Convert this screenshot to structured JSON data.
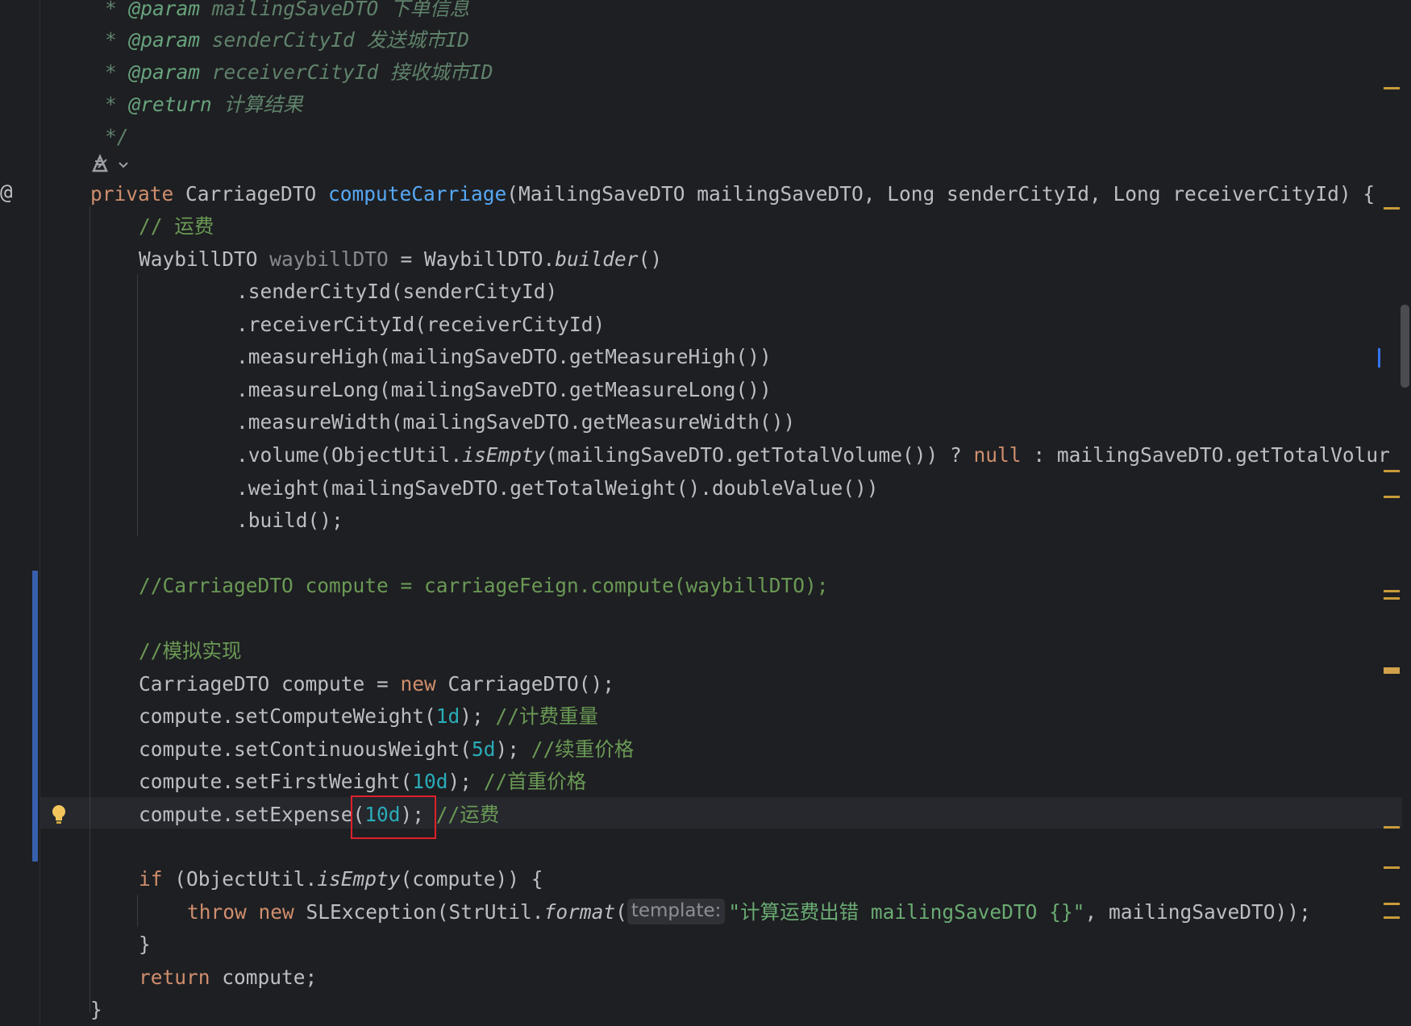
{
  "gutter": {
    "at_marker": "@"
  },
  "lines": {
    "l1_star": "* ",
    "l1_tag": "@param",
    "l1_name": " mailingSaveDTO ",
    "l1_desc": "下单信息",
    "l2_star": "* ",
    "l2_tag": "@param",
    "l2_name": " senderCityId ",
    "l2_desc": "发送城市ID",
    "l3_star": "* ",
    "l3_tag": "@param",
    "l3_name": " receiverCityId ",
    "l3_desc": "接收城市ID",
    "l4_star": "* ",
    "l4_tag": "@return",
    "l4_desc": " 计算结果",
    "l5": "*/",
    "l6_kw": "private",
    "l6_type": " CarriageDTO ",
    "l6_fn": "computeCarriage",
    "l6_rest": "(MailingSaveDTO mailingSaveDTO, Long senderCityId, Long receiverCityId) {",
    "l7": "// 运费",
    "l8_a": "WaybillDTO ",
    "l8_var": "waybillDTO",
    "l8_b": " = WaybillDTO.",
    "l8_it": "builder",
    "l8_c": "()",
    "l9": ".senderCityId(senderCityId)",
    "l10": ".receiverCityId(receiverCityId)",
    "l11": ".measureHigh(mailingSaveDTO.getMeasureHigh())",
    "l12": ".measureLong(mailingSaveDTO.getMeasureLong())",
    "l13": ".measureWidth(mailingSaveDTO.getMeasureWidth())",
    "l14_a": ".volume(ObjectUtil.",
    "l14_it": "isEmpty",
    "l14_b": "(mailingSaveDTO.getTotalVolume()) ? ",
    "l14_null": "null",
    "l14_c": " : mailingSaveDTO.getTotalVolur",
    "l15": ".weight(mailingSaveDTO.getTotalWeight().doubleValue())",
    "l16": ".build();",
    "l17": "//CarriageDTO compute = carriageFeign.compute(waybillDTO);",
    "l18": "//模拟实现",
    "l19_a": "CarriageDTO compute = ",
    "l19_kw": "new",
    "l19_b": " CarriageDTO();",
    "l20_a": "compute.setComputeWeight(",
    "l20_num": "1d",
    "l20_b": "); ",
    "l20_cm": "//计费重量",
    "l21_a": "compute.setContinuousWeight(",
    "l21_num": "5d",
    "l21_b": "); ",
    "l21_cm": "//续重价格",
    "l22_a": "compute.setFirstWeight(",
    "l22_num": "10d",
    "l22_b": "); ",
    "l22_cm": "//首重价格",
    "l23_a": "compute.setExpense(",
    "l23_num": "10d",
    "l23_b": "); ",
    "l23_cm": "//运费",
    "l24_kw": "if",
    "l24_a": " (ObjectUtil.",
    "l24_it": "isEmpty",
    "l24_b": "(compute)) {",
    "l25_kw1": "throw",
    "l25_sp": " ",
    "l25_kw2": "new",
    "l25_a": " SLException(StrUtil.",
    "l25_it": "format",
    "l25_b": "(",
    "l25_hint": "template:",
    "l25_str": "\"计算运费出错 mailingSaveDTO {}\"",
    "l25_c": ", mailingSaveDTO));",
    "l26": "}",
    "l27_kw": "return",
    "l27_a": " compute;",
    "l28": "}"
  },
  "colors": {
    "background": "#1e1f22",
    "keyword": "#cf8e6d",
    "function": "#56a8f5",
    "number": "#2aacb8",
    "comment": "#6a9955",
    "highlight_box": "#e0202a"
  },
  "icons": {
    "bulb": "lightbulb-icon",
    "ai": "ai-assistant-icon"
  }
}
